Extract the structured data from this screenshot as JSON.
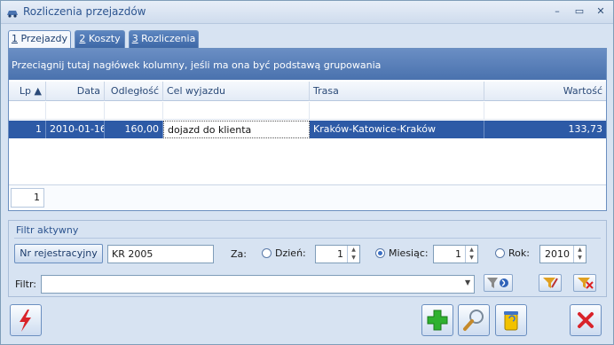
{
  "window": {
    "title": "Rozliczenia przejazdów",
    "icon": "car-icon",
    "minimize_glyph": "–",
    "maximize_glyph": "▭",
    "close_glyph": "✕"
  },
  "tabs": [
    {
      "num": "1",
      "label": " Przejazdy",
      "active": true
    },
    {
      "num": "2",
      "label": " Koszty",
      "active": false
    },
    {
      "num": "3",
      "label": " Rozliczenia",
      "active": false
    }
  ],
  "grid": {
    "group_hint": "Przeciągnij tutaj nagłówek kolumny, jeśli ma ona być podstawą grupowania",
    "columns": [
      "Lp ▲",
      "Data",
      "Odległość",
      "Cel wyjazdu",
      "Trasa",
      "Wartość"
    ],
    "rows": [
      {
        "lp": "1",
        "data": "2010-01-16",
        "odleglosc": "160,00",
        "cel": "dojazd do klienta",
        "trasa": "Kraków-Katowice-Kraków",
        "wartosc": "133,73"
      }
    ],
    "footer_count": "1"
  },
  "filter": {
    "title": "Filtr aktywny",
    "registration_button": "Nr rejestracyjny",
    "registration_value": "KR 2005",
    "za_label": "Za:",
    "day_label": "Dzień:",
    "day_value": "1",
    "month_label": "Miesiąc:",
    "month_value": "1",
    "year_label": "Rok:",
    "year_value": "2010",
    "selected_period": "month",
    "filter_label": "Filtr:",
    "filter_value": ""
  },
  "colors": {
    "accent": "#2d5aa6",
    "group_bar": "#5a80bb",
    "window_bg": "#d7e3f2"
  },
  "toolbar_icons": [
    "lightning-icon",
    "add-icon",
    "preview-icon",
    "trash-icon",
    "close-icon"
  ]
}
